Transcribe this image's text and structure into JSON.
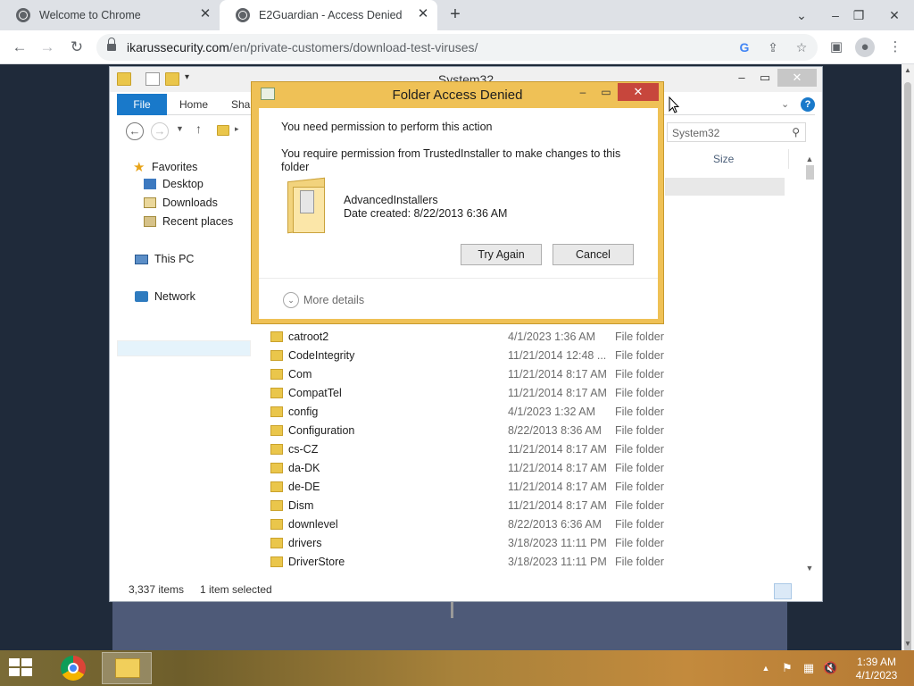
{
  "browser": {
    "tabs": [
      {
        "title": "Welcome to Chrome",
        "active": false
      },
      {
        "title": "E2Guardian - Access Denied",
        "active": true
      }
    ],
    "url": {
      "host": "ikarussecurity.com",
      "path": "/en/private-customers/download-test-viruses/"
    }
  },
  "explorer": {
    "title": "System32",
    "ribbon_tabs": [
      "File",
      "Home",
      "Share"
    ],
    "search_placeholder": "System32",
    "nav": {
      "favorites": "Favorites",
      "favorites_items": [
        "Desktop",
        "Downloads",
        "Recent places"
      ],
      "this_pc": "This PC",
      "network": "Network"
    },
    "columns": {
      "size": "Size"
    },
    "files": [
      {
        "name": "catroot2",
        "date": "4/1/2023 1:36 AM",
        "type": "File folder"
      },
      {
        "name": "CodeIntegrity",
        "date": "11/21/2014 12:48 ...",
        "type": "File folder"
      },
      {
        "name": "Com",
        "date": "11/21/2014 8:17 AM",
        "type": "File folder"
      },
      {
        "name": "CompatTel",
        "date": "11/21/2014 8:17 AM",
        "type": "File folder"
      },
      {
        "name": "config",
        "date": "4/1/2023 1:32 AM",
        "type": "File folder"
      },
      {
        "name": "Configuration",
        "date": "8/22/2013 8:36 AM",
        "type": "File folder"
      },
      {
        "name": "cs-CZ",
        "date": "11/21/2014 8:17 AM",
        "type": "File folder"
      },
      {
        "name": "da-DK",
        "date": "11/21/2014 8:17 AM",
        "type": "File folder"
      },
      {
        "name": "de-DE",
        "date": "11/21/2014 8:17 AM",
        "type": "File folder"
      },
      {
        "name": "Dism",
        "date": "11/21/2014 8:17 AM",
        "type": "File folder"
      },
      {
        "name": "downlevel",
        "date": "8/22/2013 6:36 AM",
        "type": "File folder"
      },
      {
        "name": "drivers",
        "date": "3/18/2023 11:11 PM",
        "type": "File folder"
      },
      {
        "name": "DriverStore",
        "date": "3/18/2023 11:11 PM",
        "type": "File folder"
      }
    ],
    "status": {
      "items": "3,337 items",
      "selected": "1 item selected"
    }
  },
  "dialog": {
    "title": "Folder Access Denied",
    "message": "You need permission to perform this action",
    "detail": "You require permission from TrustedInstaller to make changes to this folder",
    "folder_name": "AdvancedInstallers",
    "folder_date": "Date created: 8/22/2013 6:36 AM",
    "try_again": "Try Again",
    "cancel": "Cancel",
    "more_details": "More details"
  },
  "taskbar": {
    "time": "1:39 AM",
    "date": "4/1/2023"
  },
  "icons": {
    "back": "arrow-left",
    "forward": "arrow-right",
    "reload": "reload",
    "lock": "lock",
    "google": "google-g",
    "share": "share",
    "bookmark": "star",
    "sidebar": "side-panel",
    "profile": "person",
    "menu": "kebab"
  },
  "colors": {
    "dialog_frame": "#efc156",
    "dialog_close": "#c7463c",
    "ribbon_file": "#1979ca",
    "taskbar": "#a8823a"
  }
}
